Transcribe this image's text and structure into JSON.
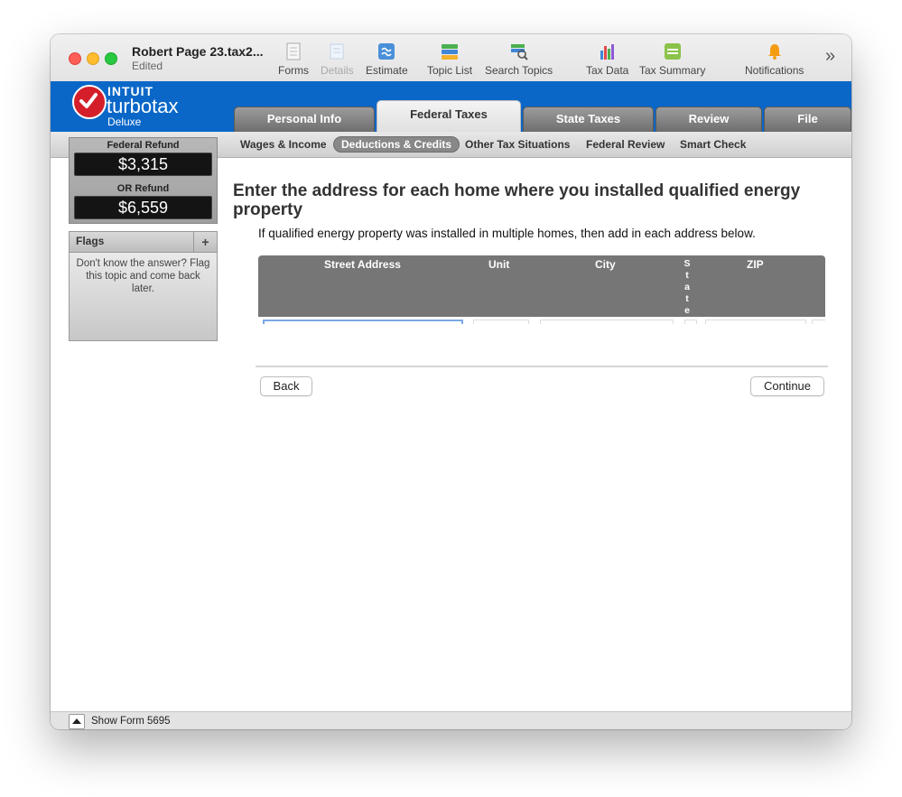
{
  "window": {
    "title": "Robert Page 23.tax2...",
    "subtitle": "Edited"
  },
  "toolbar": [
    {
      "label": "Forms",
      "icon": "forms-icon",
      "enabled": true
    },
    {
      "label": "Details",
      "icon": "details-icon",
      "enabled": false
    },
    {
      "label": "Estimate",
      "icon": "estimate-icon",
      "enabled": true
    },
    {
      "label": "Topic List",
      "icon": "topic-list-icon",
      "enabled": true
    },
    {
      "label": "Search Topics",
      "icon": "search-topics-icon",
      "enabled": true
    },
    {
      "label": "Tax Data",
      "icon": "tax-data-icon",
      "enabled": true
    },
    {
      "label": "Tax Summary",
      "icon": "tax-summary-icon",
      "enabled": true
    },
    {
      "label": "Notifications",
      "icon": "bell-icon",
      "enabled": true
    }
  ],
  "toolbar_more": "»",
  "brand": {
    "company": "INTUIT",
    "product": "turbotax",
    "edition": "Deluxe",
    "red": "#d41f2b",
    "blue": "#0a67c8"
  },
  "main_tabs": [
    {
      "label": "Personal Info",
      "active": false
    },
    {
      "label": "Federal Taxes",
      "active": true
    },
    {
      "label": "State Taxes",
      "active": false
    },
    {
      "label": "Review",
      "active": false
    },
    {
      "label": "File",
      "active": false
    }
  ],
  "sub_tabs": [
    {
      "label": "Wages & Income",
      "active": false
    },
    {
      "label": "Deductions & Credits",
      "active": true
    },
    {
      "label": "Other Tax Situations",
      "active": false
    },
    {
      "label": "Federal Review",
      "active": false
    },
    {
      "label": "Smart Check",
      "active": false
    }
  ],
  "refund": {
    "federal_label": "Federal Refund",
    "federal_value": "$3,315",
    "or_label": "OR Refund",
    "or_value": "$6,559"
  },
  "flags": {
    "title": "Flags",
    "add": "+",
    "message": "Don't know the answer? Flag this topic and come back later."
  },
  "main": {
    "title": "Enter the address for each home where you installed qualified energy property",
    "subtitle": "If qualified energy property was installed in multiple homes, then add in each address below.",
    "table_columns": {
      "street": "Street Address",
      "unit": "Unit",
      "city": "City",
      "state": "State",
      "zip": "ZIP"
    },
    "back_label": "Back",
    "continue_label": "Continue"
  },
  "bottom": {
    "label": "Show Form 5695"
  }
}
